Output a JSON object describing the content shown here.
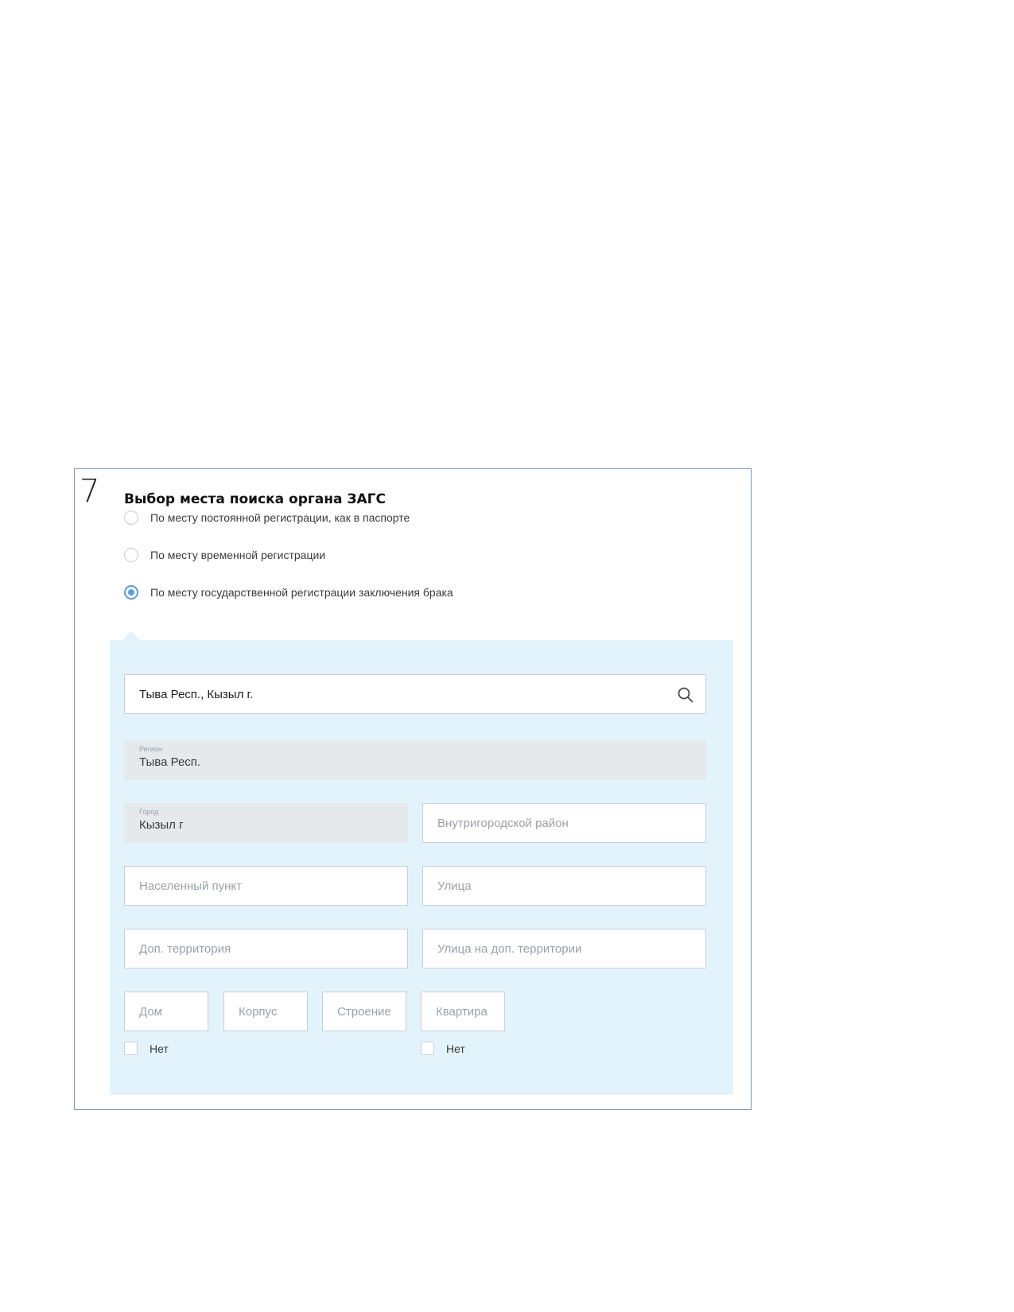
{
  "step": {
    "number": "7"
  },
  "section": {
    "title": "Выбор места поиска органа ЗАГС"
  },
  "radios": [
    {
      "label": "По месту постоянной регистрации, как в паспорте",
      "checked": false
    },
    {
      "label": "По месту временной регистрации",
      "checked": false
    },
    {
      "label": "По месту государственной регистрации заключения брака",
      "checked": true
    }
  ],
  "address": {
    "search_value": "Тыва Респ., Кызыл г.",
    "region": {
      "label": "Регион",
      "value": "Тыва Респ."
    },
    "city": {
      "label": "Город",
      "value": "Кызыл г"
    },
    "district_placeholder": "Внутригородской район",
    "settlement_placeholder": "Населенный пункт",
    "street_placeholder": "Улица",
    "extra_territory_placeholder": "Доп. территория",
    "extra_street_placeholder": "Улица на доп. территории",
    "house_placeholder": "Дом",
    "building_placeholder": "Корпус",
    "structure_placeholder": "Строение",
    "apartment_placeholder": "Квартира",
    "no_house_label": "Нет",
    "no_apartment_label": "Нет"
  },
  "colors": {
    "frame_border": "#7f98c0",
    "panel_bg": "#e3f3fc",
    "radio_accent": "#5a9fd7",
    "disabled_field": "#e6e9ec"
  }
}
